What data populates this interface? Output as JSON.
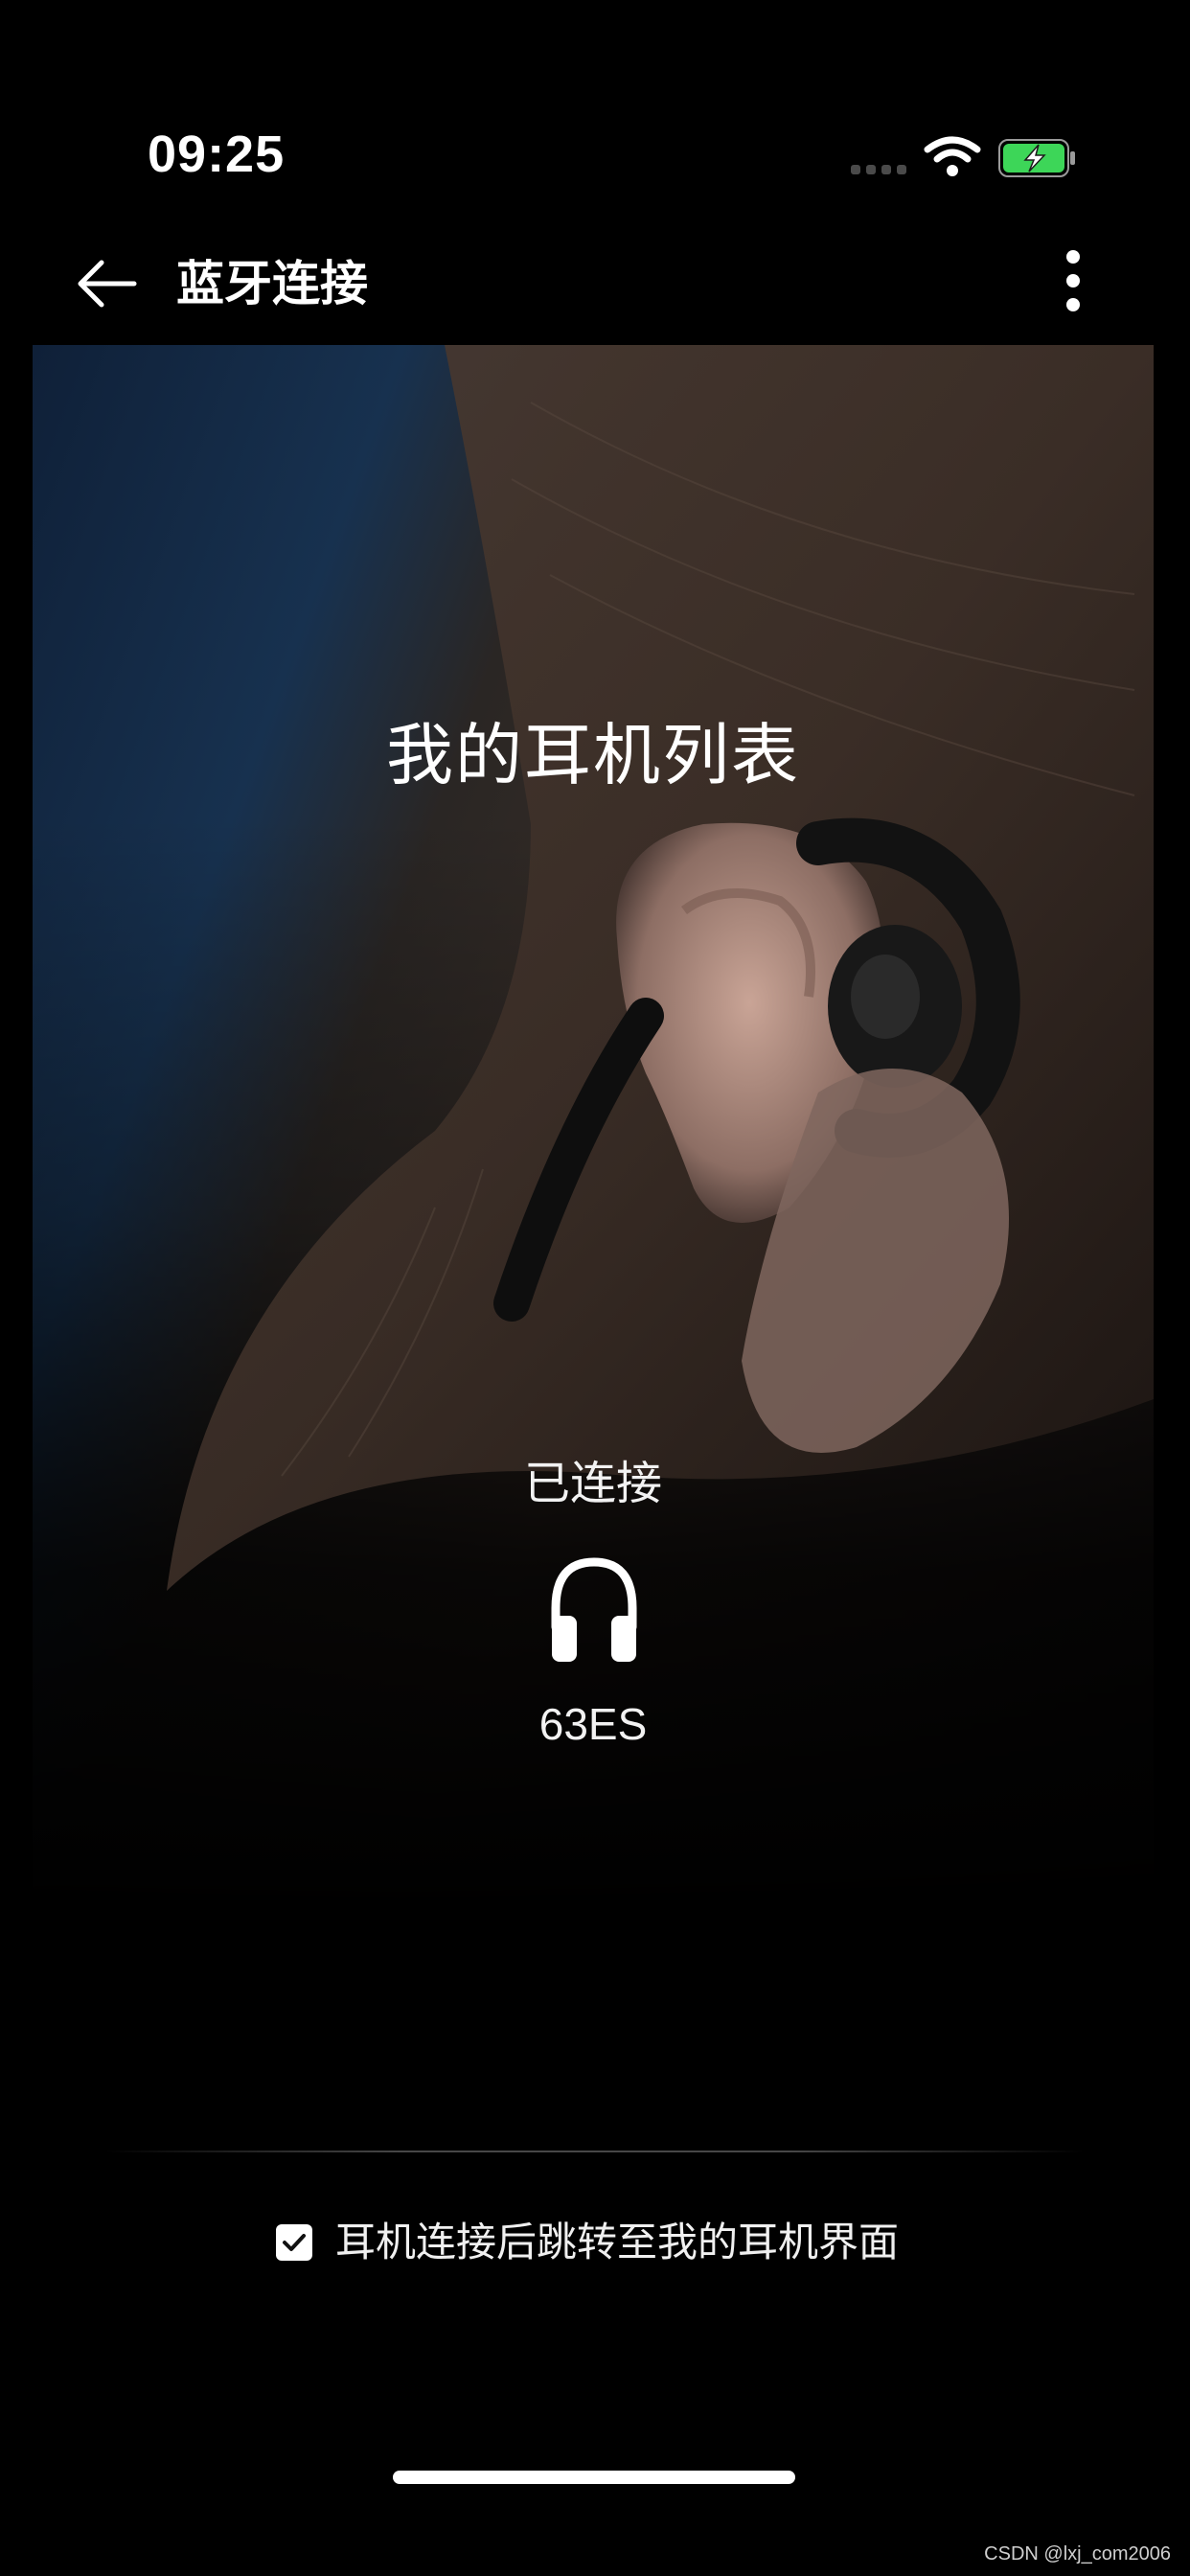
{
  "status_bar": {
    "time": "09:25",
    "icons": [
      "cellular-signal-icon",
      "wifi-icon",
      "battery-charging-icon"
    ],
    "battery_color": "#3dd658"
  },
  "nav": {
    "back_icon": "arrow-left-icon",
    "title": "蓝牙连接",
    "more_icon": "more-vertical-icon"
  },
  "hero": {
    "title": "我的耳机列表",
    "image_subject": "person-wearing-earphone-photo"
  },
  "device": {
    "status": "已连接",
    "icon": "headphones-icon",
    "name": "63ES"
  },
  "option": {
    "checked": true,
    "label": "耳机连接后跳转至我的耳机界面"
  },
  "watermark": "CSDN @lxj_com2006"
}
